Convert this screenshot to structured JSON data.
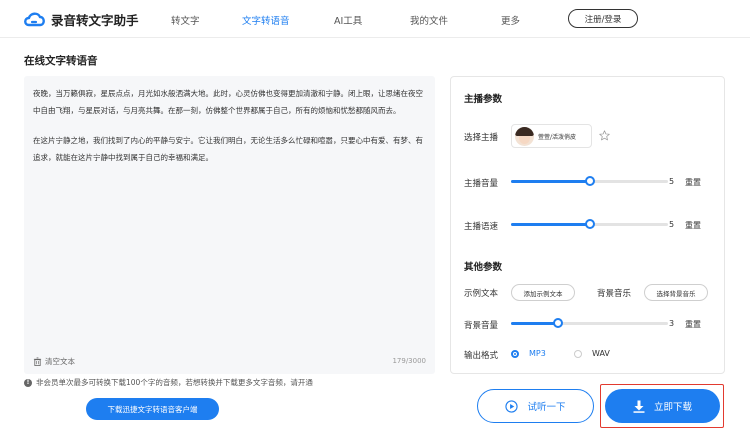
{
  "header": {
    "logo_text": "录音转文字助手",
    "nav": [
      {
        "label": "转文字"
      },
      {
        "label": "文字转语音"
      },
      {
        "label": "AI工具"
      },
      {
        "label": "我的文件"
      },
      {
        "label": "更多"
      }
    ],
    "login_label": "注册/登录"
  },
  "page_title": "在线文字转语音",
  "editor": {
    "paragraph1": "夜晚，当万籁俱寂，星辰点点，月光如水般洒满大地。此时，心灵仿佛也变得更加清澈和宁静。闭上眼，让思绪在夜空中自由飞翔，与星辰对话，与月亮共舞。在那一刻，仿佛整个世界都属于自己，所有的烦恼和忧愁都随风而去。",
    "paragraph2": "在这片宁静之地，我们找到了内心的平静与安宁。它让我们明白，无论生活多么忙碌和喧嚣，只要心中有爱、有梦、有追求，就能在这片宁静中找到属于自己的幸福和满足。",
    "clear_label": "清空文本",
    "char_count": "179/3000"
  },
  "notice": {
    "icon_text": "!",
    "text": "非会员单次最多可转换下载100个字的音频，若想转换并下载更多文字音频，请开通"
  },
  "download_client_label": "下载迅捷文字转语音客户端",
  "params": {
    "anchor_section": "主播参数",
    "select_anchor_label": "选择主播",
    "voice_name": "萱萱/活泼俏皮",
    "volume_label": "主播音量",
    "volume_value": "5",
    "volume_fraction": 0.5,
    "speed_label": "主播语速",
    "speed_value": "5",
    "speed_fraction": 0.5,
    "reset_label": "重置",
    "other_section": "其他参数",
    "sample_text_label": "示例文本",
    "add_sample_label": "添加示例文本",
    "bg_music_label": "背景音乐",
    "select_bg_music_label": "选择背景音乐",
    "bg_volume_label": "背景音量",
    "bg_volume_value": "3",
    "bg_volume_fraction": 0.3,
    "format_label": "输出格式",
    "formats": [
      {
        "label": "MP3",
        "selected": true
      },
      {
        "label": "WAV",
        "selected": false
      }
    ]
  },
  "actions": {
    "preview_label": "试听一下",
    "download_label": "立即下载"
  },
  "colors": {
    "accent": "#1e7ef0",
    "highlight": "#e23a2f"
  }
}
